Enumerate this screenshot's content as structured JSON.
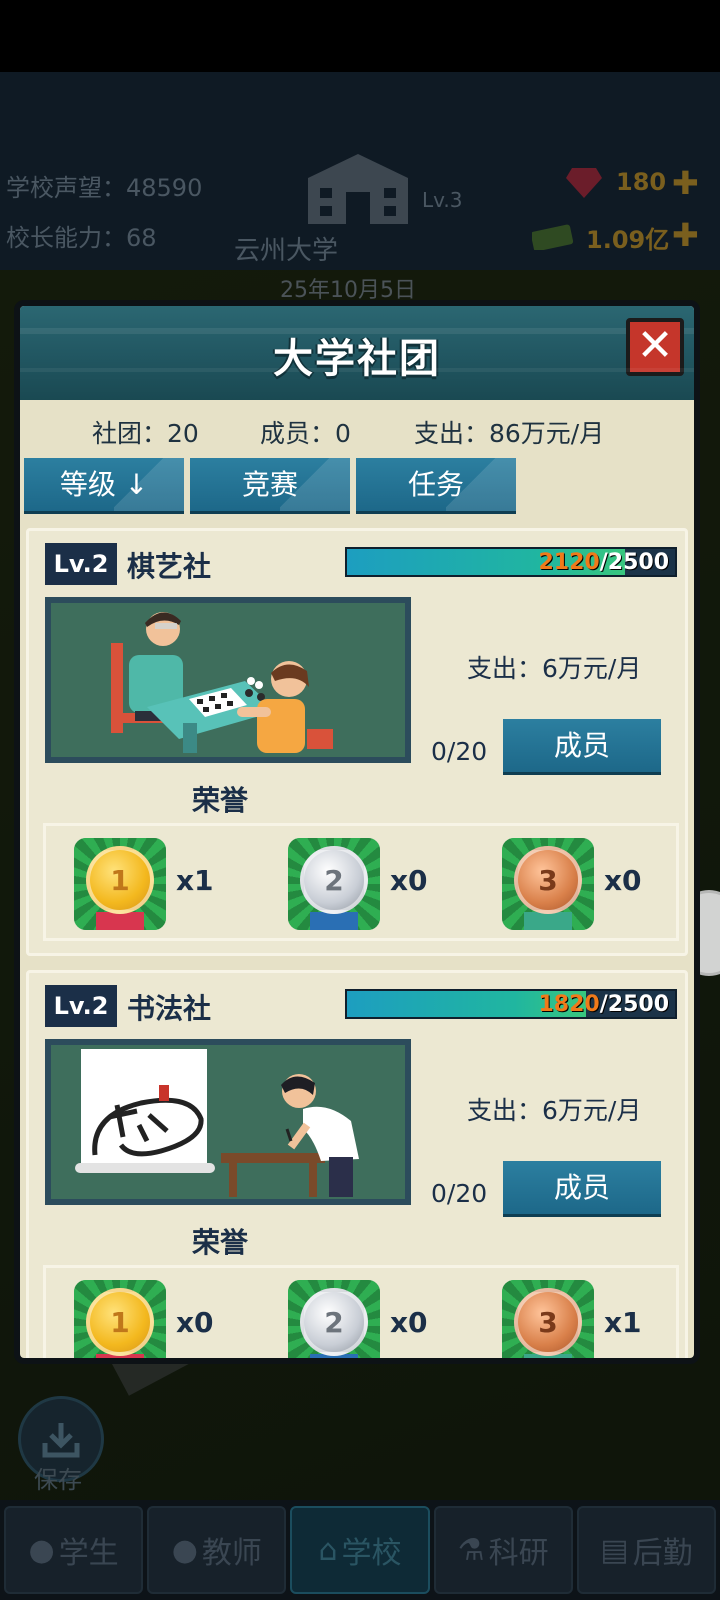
{
  "top": {
    "reputation_label": "学校声望：48590",
    "ability_label": "校长能力：68",
    "school_level": "Lv.3",
    "school_name": "云州大学",
    "date": "25年10月5日",
    "gems": "180",
    "money": "1.09亿"
  },
  "modal": {
    "title": "大学社团",
    "close_label": "✕",
    "stats": {
      "clubs": "社团：20",
      "members": "成员：0",
      "expense": "支出：86万元/月"
    },
    "filters": [
      {
        "label": "等级 ↓"
      },
      {
        "label": "竞赛"
      },
      {
        "label": "任务"
      }
    ],
    "clubs": [
      {
        "level": "Lv.2",
        "name": "棋艺社",
        "progress_current": "2120",
        "progress_max": "/2500",
        "progress_fraction": 0.848,
        "expense": "支出：6万元/月",
        "members": "0/20",
        "members_button": "成员",
        "honor_title": "荣誉",
        "medals": [
          {
            "rank": "1",
            "count": "x1"
          },
          {
            "rank": "2",
            "count": "x0"
          },
          {
            "rank": "3",
            "count": "x0"
          }
        ]
      },
      {
        "level": "Lv.2",
        "name": "书法社",
        "progress_current": "1820",
        "progress_max": "/2500",
        "progress_fraction": 0.728,
        "expense": "支出：6万元/月",
        "members": "0/20",
        "members_button": "成员",
        "honor_title": "荣誉",
        "medals": [
          {
            "rank": "1",
            "count": "x0"
          },
          {
            "rank": "2",
            "count": "x0"
          },
          {
            "rank": "3",
            "count": "x1"
          }
        ]
      }
    ]
  },
  "save_label": "保存",
  "nav": [
    {
      "label": "学生",
      "icon": "student-icon"
    },
    {
      "label": "教师",
      "icon": "teacher-icon"
    },
    {
      "label": "学校",
      "icon": "school-icon"
    },
    {
      "label": "科研",
      "icon": "research-icon"
    },
    {
      "label": "后勤",
      "icon": "logistics-icon"
    }
  ],
  "colors": {
    "gold": "#f3b81e",
    "silver": "#bfc4cb",
    "bronze": "#d9804a",
    "accent": "#1d6889"
  }
}
